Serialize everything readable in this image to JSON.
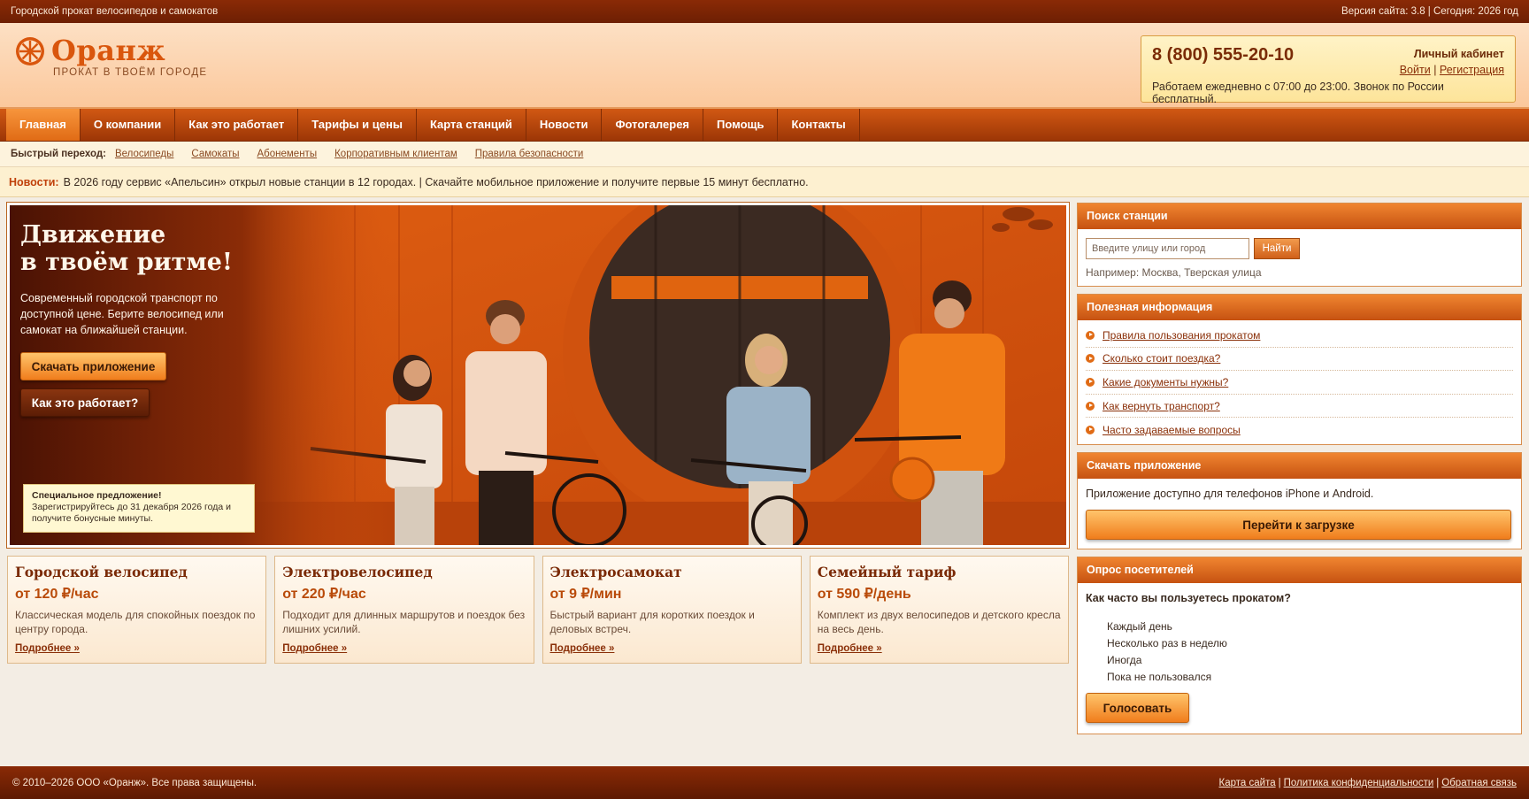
{
  "topbar": {
    "left": "Городской прокат велосипедов и самокатов",
    "right": "Версия сайта: 3.8 | Сегодня: 2026 год"
  },
  "header": {
    "logo_name": "Оранж",
    "logo_tagline": "ПРОКАТ В ТВОЁМ ГОРОДЕ",
    "phone": "8 (800) 555-20-10",
    "cabinet_title": "Личный кабинет",
    "login": "Войти",
    "register": "Регистрация",
    "hours": "Работаем ежедневно с 07:00 до 23:00. Звонок по России бесплатный."
  },
  "nav": {
    "items": [
      "Главная",
      "О компании",
      "Как это работает",
      "Тарифы и цены",
      "Карта станций",
      "Новости",
      "Фотогалерея",
      "Помощь",
      "Контакты"
    ],
    "active": "Главная"
  },
  "quick": {
    "label": "Быстрый переход:",
    "links": [
      "Велосипеды",
      "Самокаты",
      "Абонементы",
      "Корпоративным клиентам",
      "Правила безопасности"
    ]
  },
  "news": {
    "label": "Новости:",
    "text": "В 2026 году сервис «Апельсин» открыл новые станции в 12 городах. | Скачайте мобильное приложение и получите первые 15 минут бесплатно."
  },
  "hero": {
    "title_line1": "Движение",
    "title_line2": "в твоём ритме!",
    "description": "Современный городской транспорт по доступной цене. Берите велосипед или самокат на ближайшей станции.",
    "btn_download": "Скачать приложение",
    "btn_how": "Как это работает?",
    "special_title": "Специальное предложение!",
    "special_text": "Зарегистрируйтесь до 31 декабря 2026 года и получите бонусные минуты."
  },
  "cards": [
    {
      "title": "Городской велосипед",
      "price": "от 120 ₽/час",
      "desc": "Классическая модель для спокойных поездок по центру города.",
      "more": "Подробнее »"
    },
    {
      "title": "Электровелосипед",
      "price": "от 220 ₽/час",
      "desc": "Подходит для длинных маршрутов и поездок без лишних усилий.",
      "more": "Подробнее »"
    },
    {
      "title": "Электросамокат",
      "price": "от 9 ₽/мин",
      "desc": "Быстрый вариант для коротких поездок и деловых встреч.",
      "more": "Подробнее »"
    },
    {
      "title": "Семейный тариф",
      "price": "от 590 ₽/день",
      "desc": "Комплект из двух велосипедов и детского кресла на весь день.",
      "more": "Подробнее »"
    }
  ],
  "sidebar": {
    "search": {
      "title": "Поиск станции",
      "placeholder": "Введите улицу или город",
      "button": "Найти",
      "hint": "Например: Москва, Тверская улица"
    },
    "info": {
      "title": "Полезная информация",
      "links": [
        "Правила пользования прокатом",
        "Сколько стоит поездка?",
        "Какие документы нужны?",
        "Как вернуть транспорт?",
        "Часто задаваемые вопросы"
      ]
    },
    "app": {
      "title": "Скачать приложение",
      "text": "Приложение доступно для телефонов iPhone и Android.",
      "button": "Перейти к загрузке"
    },
    "poll": {
      "title": "Опрос посетителей",
      "question": "Как часто вы пользуетесь прокатом?",
      "options": [
        "Каждый день",
        "Несколько раз в неделю",
        "Иногда",
        "Пока не пользовался"
      ],
      "button": "Голосовать"
    }
  },
  "footer": {
    "copyright": "© 2010–2026 ООО «Оранж». Все права защищены.",
    "links": [
      "Карта сайта",
      "Политика конфиденциальности",
      "Обратная связь"
    ]
  },
  "colors": {
    "brand_orange": "#d9560d",
    "dark_brown": "#6d1f03",
    "accent_button": "#f07d1c"
  }
}
